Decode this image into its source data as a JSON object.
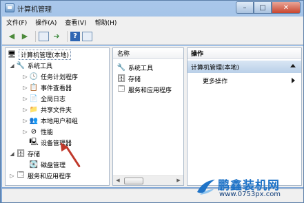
{
  "window": {
    "title": "计算机管理",
    "controls": {
      "minimize": "–",
      "maximize": "□",
      "close": "✕"
    }
  },
  "menu": [
    "文件(F)",
    "操作(A)",
    "查看(V)",
    "帮助(H)"
  ],
  "toolbar": {
    "help_glyph": "?"
  },
  "tree": {
    "root": "计算机管理(本地)",
    "nodes": [
      {
        "label": "系统工具",
        "level": 1,
        "expander": "◢",
        "icon": "tools-icon"
      },
      {
        "label": "任务计划程序",
        "level": 2,
        "expander": "▷",
        "icon": "clock-icon"
      },
      {
        "label": "事件查看器",
        "level": 2,
        "expander": "▷",
        "icon": "event-viewer-icon"
      },
      {
        "label": "全局日志",
        "level": 2,
        "expander": "▷",
        "icon": "log-icon"
      },
      {
        "label": "共享文件夹",
        "level": 2,
        "expander": "▷",
        "icon": "shared-folder-icon"
      },
      {
        "label": "本地用户和组",
        "level": 2,
        "expander": "▷",
        "icon": "users-icon"
      },
      {
        "label": "性能",
        "level": 2,
        "expander": "▷",
        "icon": "performance-icon"
      },
      {
        "label": "设备管理器",
        "level": 2,
        "expander": "",
        "icon": "device-manager-icon"
      },
      {
        "label": "存储",
        "level": 1,
        "expander": "◢",
        "icon": "storage-icon"
      },
      {
        "label": "磁盘管理",
        "level": 2,
        "expander": "",
        "icon": "disk-icon"
      },
      {
        "label": "服务和应用程序",
        "level": 1,
        "expander": "▷",
        "icon": "services-icon"
      }
    ]
  },
  "list": {
    "column": "名称",
    "items": [
      {
        "label": "系统工具",
        "icon": "tools-icon"
      },
      {
        "label": "存储",
        "icon": "storage-icon"
      },
      {
        "label": "服务和应用程序",
        "icon": "services-icon"
      }
    ]
  },
  "actions": {
    "header": "操作",
    "section": "计算机管理(本地)",
    "more": "更多操作"
  },
  "watermark": {
    "title": "鹏鑫装机网",
    "url": "www.0753px.com"
  }
}
